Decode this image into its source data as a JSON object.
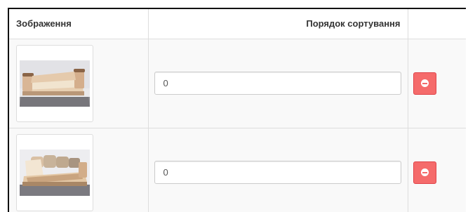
{
  "table": {
    "headers": {
      "image": "Зображення",
      "sort_order": "Порядок сортування",
      "action": ""
    },
    "rows": [
      {
        "image_alt": "sofa-folded-photo",
        "sort_order": "0"
      },
      {
        "image_alt": "sofa-open-storage-photo",
        "sort_order": "0"
      }
    ]
  },
  "colors": {
    "remove_button": "#f56b6b",
    "row_background": "#f9f9f9",
    "border": "#dddddd"
  },
  "icons": {
    "remove": "minus-circle-icon"
  }
}
